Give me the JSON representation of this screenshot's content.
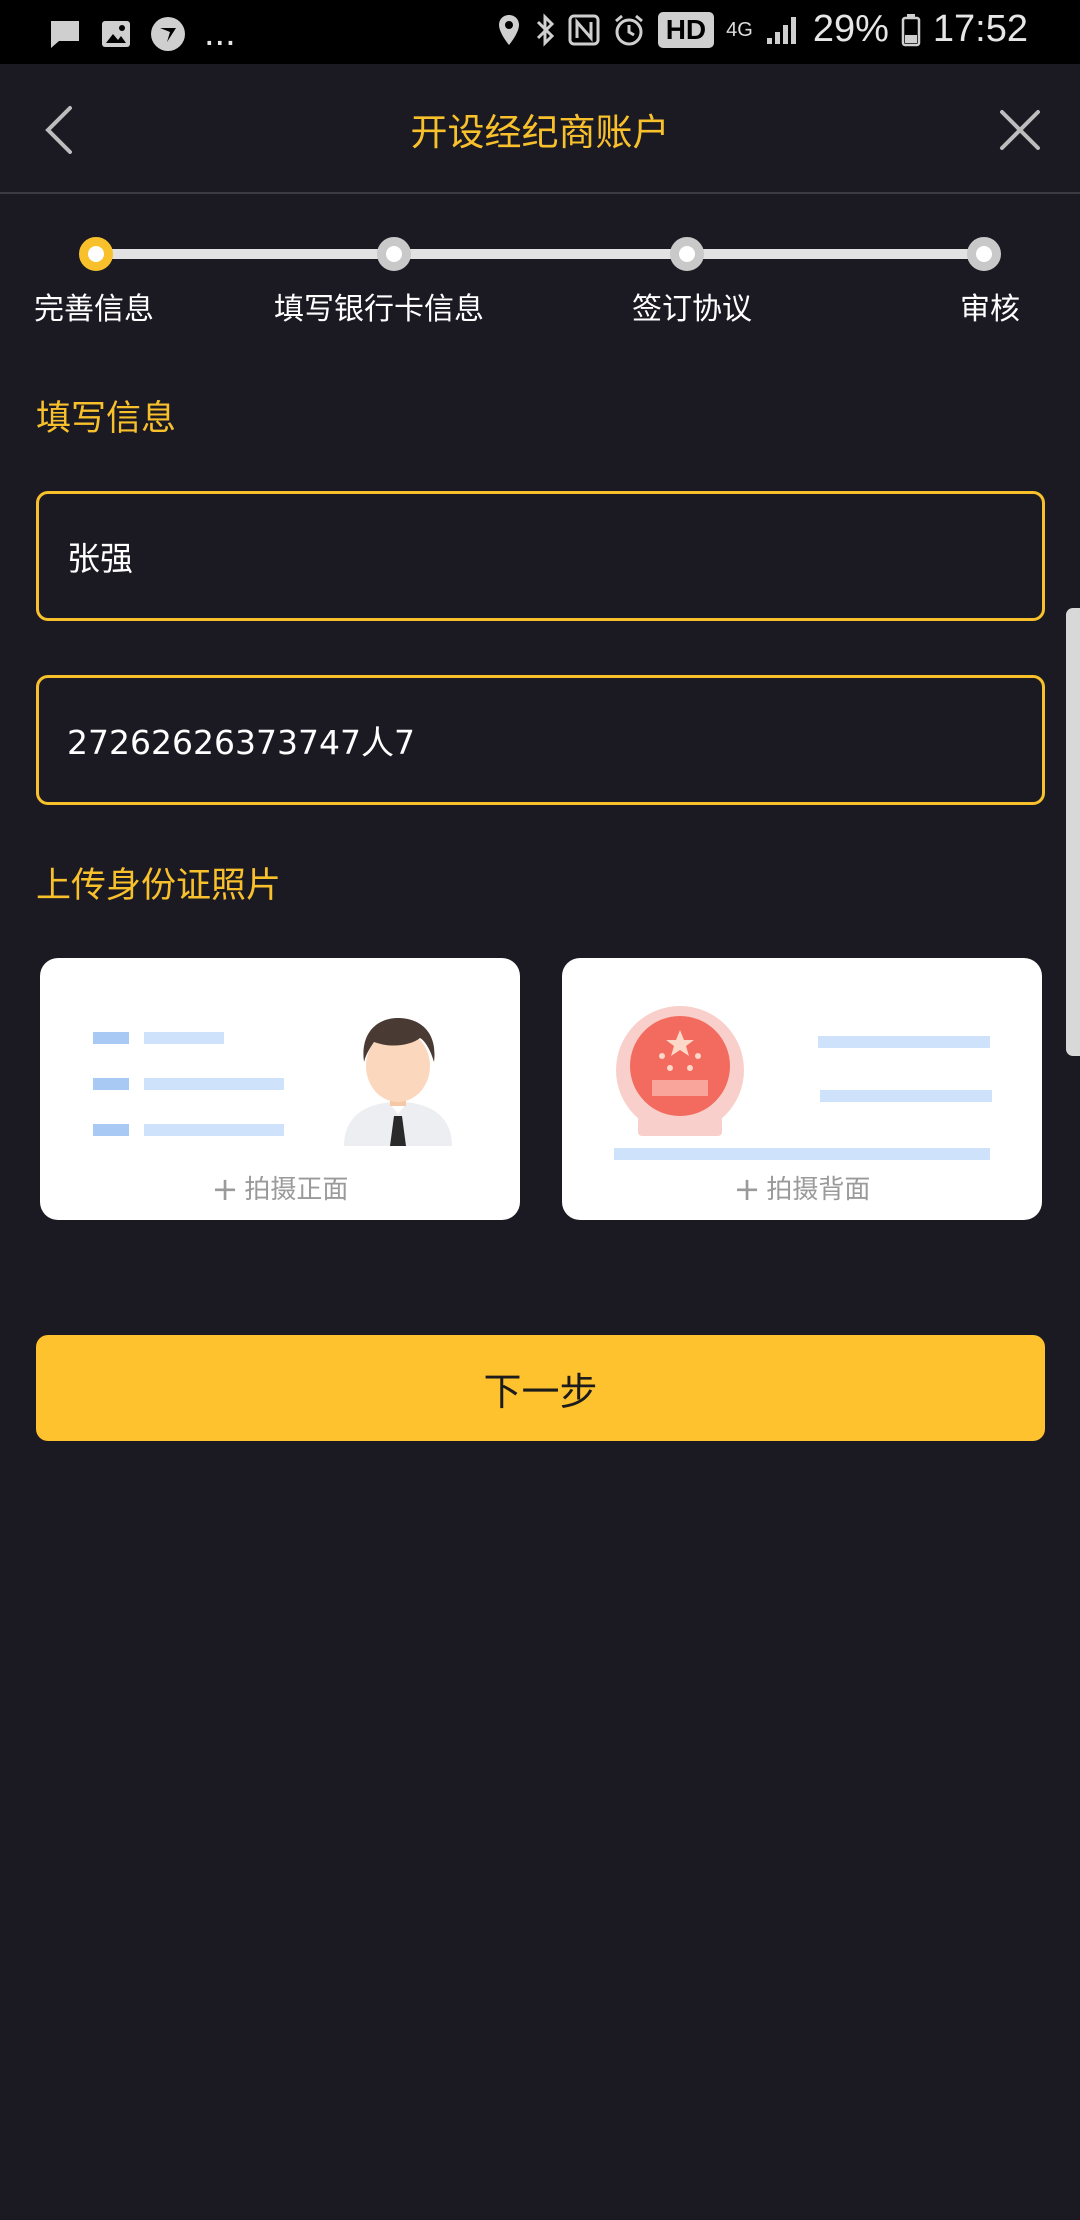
{
  "status_bar": {
    "battery": "29%",
    "time": "17:52",
    "more": "...",
    "hd": "HD",
    "network": "4G"
  },
  "header": {
    "title": "开设经纪商账户"
  },
  "steps": [
    {
      "label": "完善信息",
      "active": true
    },
    {
      "label": "填写银行卡信息",
      "active": false
    },
    {
      "label": "签订协议",
      "active": false
    },
    {
      "label": "审核",
      "active": false
    }
  ],
  "form": {
    "section_title": "填写信息",
    "name_value": "张强",
    "id_value": "27262626373747人7"
  },
  "upload": {
    "section_title": "上传身份证照片",
    "front_label": "拍摄正面",
    "back_label": "拍摄背面",
    "plus": "+"
  },
  "next_button": "下一步",
  "colors": {
    "accent": "#f8c12c",
    "button": "#fec22e",
    "background": "#1b1a23"
  }
}
